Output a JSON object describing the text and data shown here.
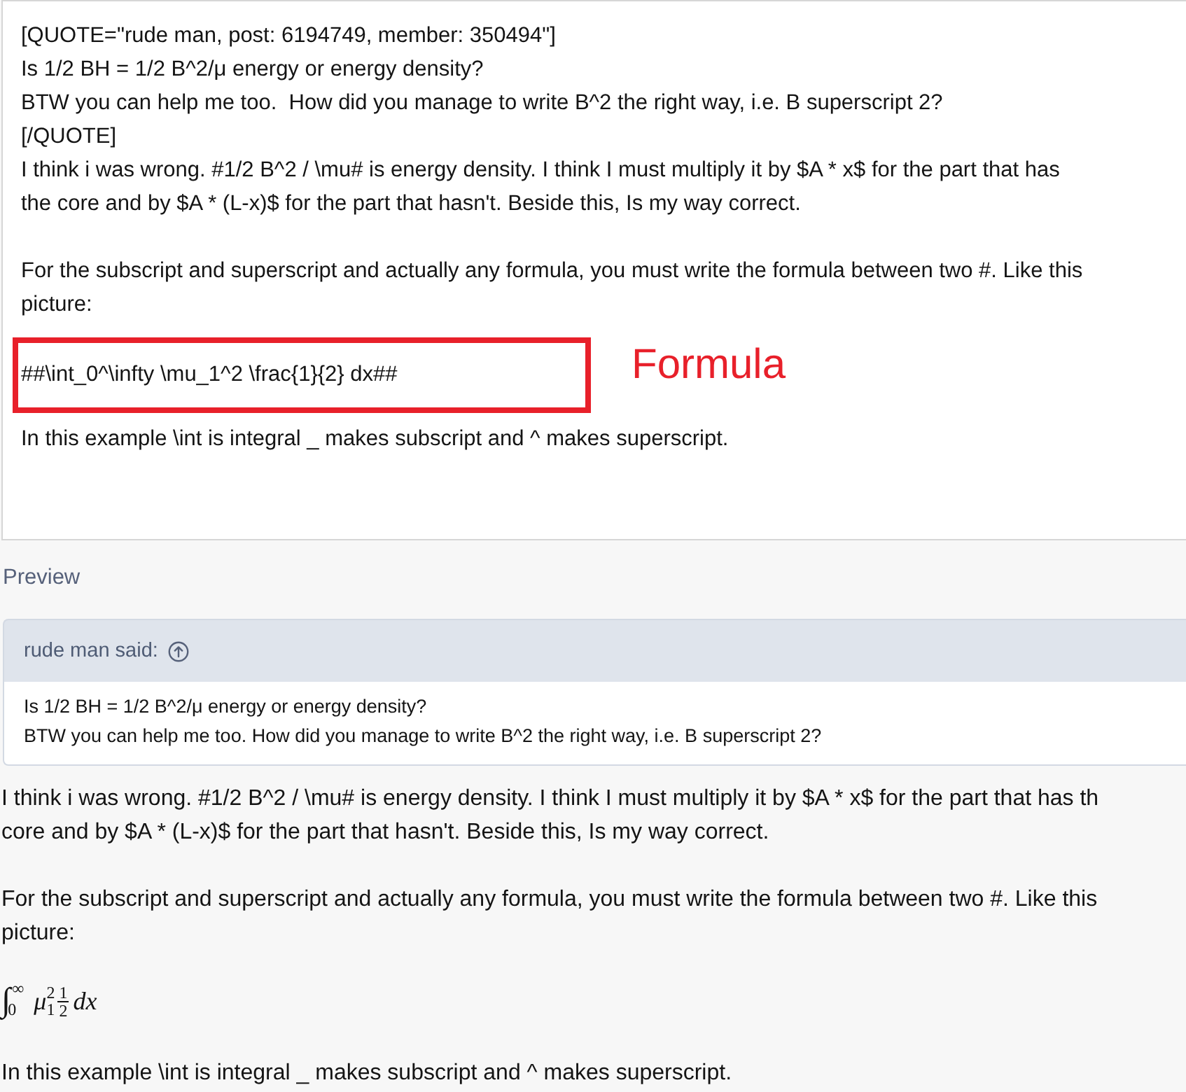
{
  "editor": {
    "paragraphs": [
      {
        "kind": "text",
        "lines": [
          "[QUOTE=\"rude man, post: 6194749, member: 350494\"]",
          "Is 1/2 BH = 1/2 B^2/μ energy or energy density?",
          "BTW you can help me too.  How did you manage to write B^2 the right way, i.e. B superscript 2?",
          "[/QUOTE]",
          "I think i was wrong. #1/2 B^2 / \\mu# is energy density. I think I must multiply it by $A * x$ for the part that has",
          "the core and by $A * (L-x)$ for the part that hasn't. Beside this, Is my way correct."
        ]
      },
      {
        "kind": "text",
        "lines": [
          "For the subscript and superscript and actually any formula, you must write the formula between two #. Like this",
          "picture:"
        ]
      },
      {
        "kind": "highlight",
        "lines": [
          "##\\int_0^\\infty \\mu_1^2 \\frac{1}{2} dx##"
        ],
        "note": "Formula"
      },
      {
        "kind": "text",
        "lines": [
          "In this example \\int is integral _ makes subscript and ^ makes superscript."
        ]
      }
    ]
  },
  "preview": {
    "label": "Preview",
    "quote": {
      "author": "rude man said:",
      "lines": [
        "Is 1/2 BH = 1/2 B^2/μ energy or energy density?",
        "BTW you can help me too. How did you manage to write B^2 the right way, i.e. B superscript 2?"
      ]
    },
    "paragraphs": [
      {
        "kind": "text",
        "lines": [
          "I think i was wrong. #1/2 B^2 / \\mu# is energy density. I think I must multiply it by $A * x$ for the part that has th",
          "core and by $A * (L-x)$ for the part that hasn't. Beside this, Is my way correct."
        ]
      },
      {
        "kind": "text",
        "lines": [
          "For the subscript and superscript and actually any formula, you must write the formula between two #. Like this",
          "picture:"
        ]
      },
      {
        "kind": "math",
        "integral": "∫",
        "lower": "0",
        "upper": "∞",
        "base": "μ",
        "sub": "1",
        "sup": "2",
        "numerator": "1",
        "denominator": "2",
        "differential": "dx"
      },
      {
        "kind": "text",
        "lines": [
          "In this example \\int is integral _ makes subscript and ^ makes superscript."
        ]
      }
    ]
  }
}
